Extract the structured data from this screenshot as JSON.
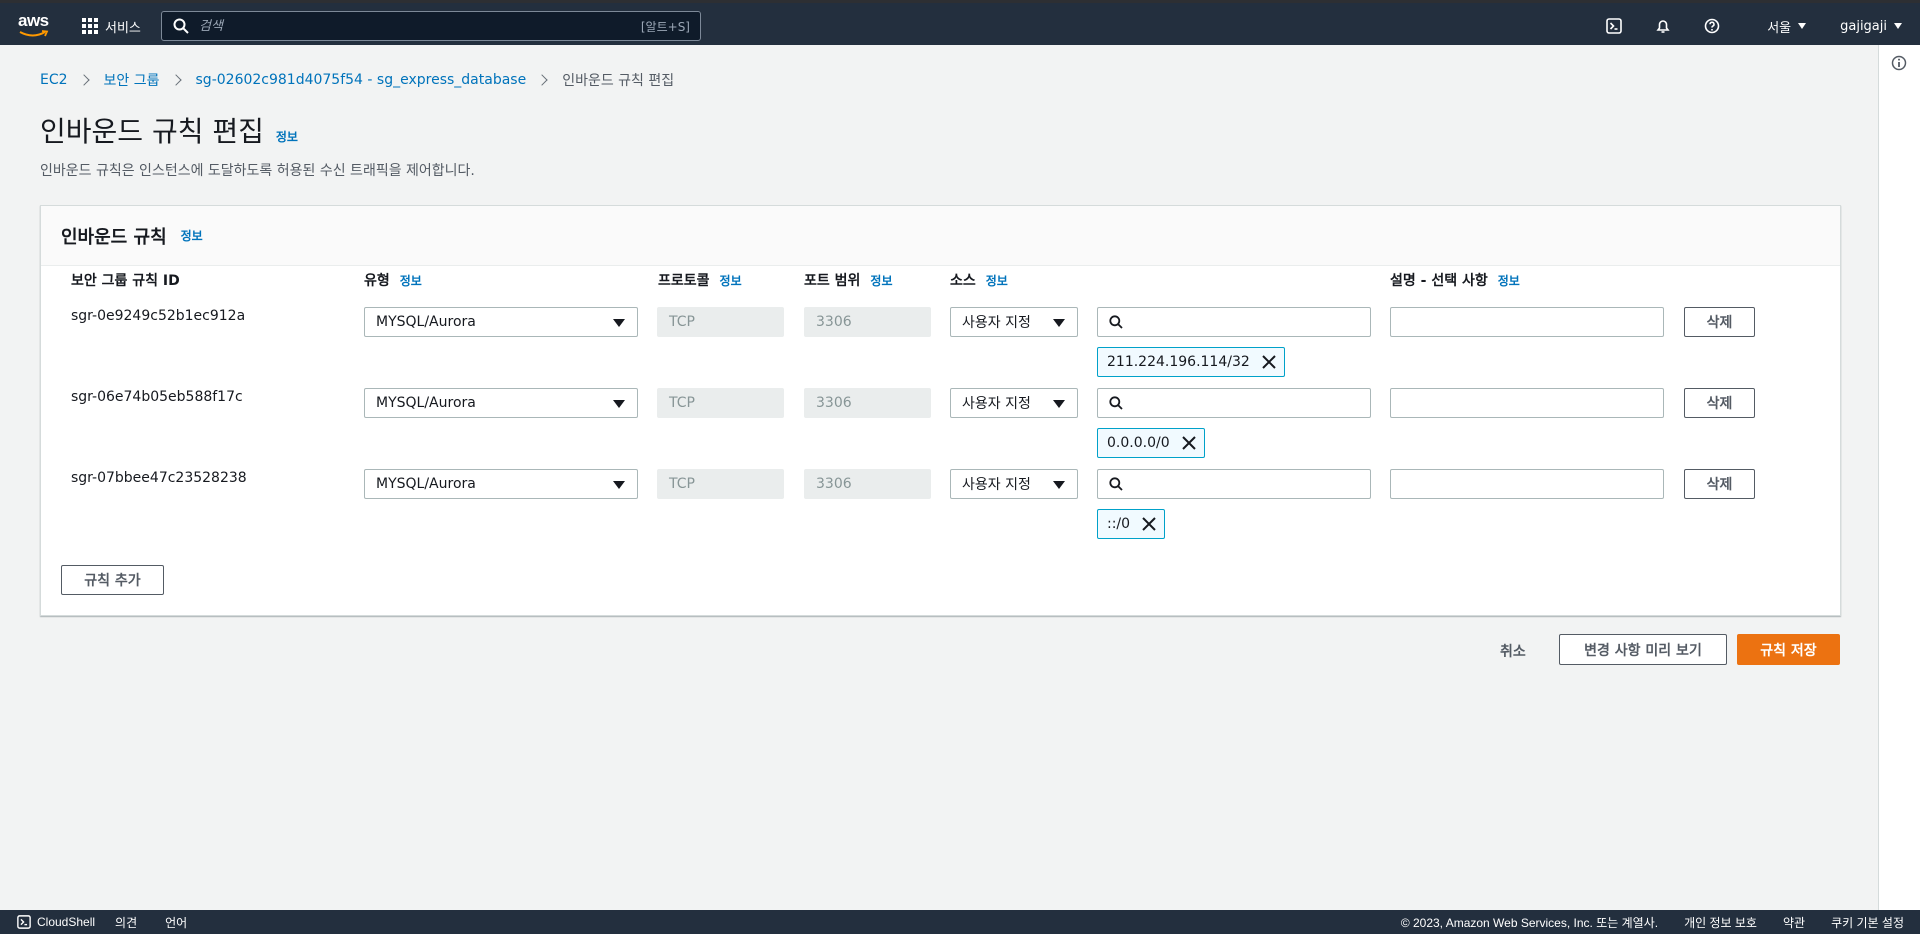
{
  "topnav": {
    "logo_text": "aws",
    "services_label": "서비스",
    "search_placeholder": "검색",
    "search_shortcut": "[알트+S]",
    "region": "서울",
    "user": "gajigaji"
  },
  "breadcrumb": {
    "items": [
      "EC2",
      "보안 그룹",
      "sg-02602c981d4075f54 - sg_express_database"
    ],
    "current": "인바운드 규칙 편집"
  },
  "page": {
    "title": "인바운드 규칙 편집",
    "info": "정보",
    "description": "인바운드 규칙은 인스턴스에 도달하도록 허용된 수신 트래픽을 제어합니다."
  },
  "panel": {
    "title": "인바운드 규칙",
    "info": "정보",
    "columns": {
      "rule_id": "보안 그룹 규칙 ID",
      "type": "유형",
      "protocol": "프로토콜",
      "port_range": "포트 범위",
      "source": "소스",
      "description": "설명 - 선택 사항",
      "info": "정보"
    },
    "rules": [
      {
        "id": "sgr-0e9249c52b1ec912a",
        "type": "MYSQL/Aurora",
        "protocol": "TCP",
        "port": "3306",
        "source_type": "사용자 지정",
        "source_token": "211.224.196.114/32",
        "delete_label": "삭제"
      },
      {
        "id": "sgr-06e74b05eb588f17c",
        "type": "MYSQL/Aurora",
        "protocol": "TCP",
        "port": "3306",
        "source_type": "사용자 지정",
        "source_token": "0.0.0.0/0",
        "delete_label": "삭제"
      },
      {
        "id": "sgr-07bbee47c23528238",
        "type": "MYSQL/Aurora",
        "protocol": "TCP",
        "port": "3306",
        "source_type": "사용자 지정",
        "source_token": "::/0",
        "delete_label": "삭제"
      }
    ],
    "add_rule_label": "규칙 추가"
  },
  "actions": {
    "cancel": "취소",
    "preview": "변경 사항 미리 보기",
    "save": "규칙 저장"
  },
  "bottombar": {
    "cloudshell": "CloudShell",
    "feedback": "의견",
    "language": "언어",
    "copyright": "© 2023, Amazon Web Services, Inc. 또는 계열사.",
    "privacy": "개인 정보 보호",
    "terms": "약관",
    "cookies": "쿠키 기본 설정"
  },
  "colors": {
    "nav_bg": "#232f3e",
    "link": "#0073bb",
    "primary": "#ec7211",
    "token_border": "#00a1c9"
  }
}
